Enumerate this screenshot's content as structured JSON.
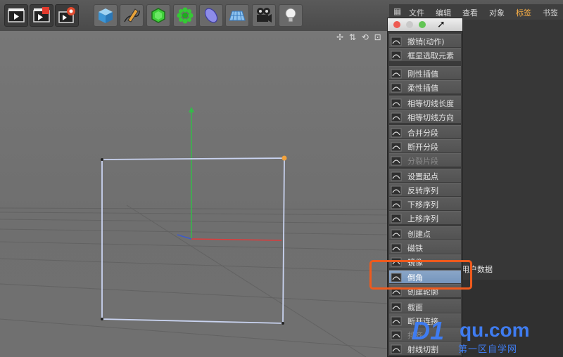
{
  "toolbar": {
    "buttons": [
      {
        "name": "render-view-icon"
      },
      {
        "name": "render-to-picture-viewer-icon"
      },
      {
        "name": "render-settings-icon"
      },
      {
        "name": "cube-icon"
      },
      {
        "name": "pen-spline-icon"
      },
      {
        "name": "subdivision-icon"
      },
      {
        "name": "array-icon"
      },
      {
        "name": "deformer-icon"
      },
      {
        "name": "floor-icon"
      },
      {
        "name": "camera-icon"
      },
      {
        "name": "light-icon"
      }
    ]
  },
  "menubar": {
    "items": [
      "文件",
      "编辑",
      "查看",
      "对象",
      "标签",
      "书签"
    ],
    "active": "标签"
  },
  "viewport": {
    "nav_icons": "✢ ⇅ ⟲ ⊡"
  },
  "popup_menu": {
    "items": [
      {
        "label": "撤销(动作)",
        "icon": "undo-icon",
        "state": "normal"
      },
      {
        "label": "框显选取元素",
        "icon": "frame-selection-icon",
        "state": "normal"
      },
      {
        "label": "刚性插值",
        "icon": "hard-interpolation-icon",
        "state": "normal"
      },
      {
        "label": "柔性插值",
        "icon": "soft-interpolation-icon",
        "state": "normal"
      },
      {
        "label": "相等切线长度",
        "icon": "equal-tangent-length-icon",
        "state": "normal"
      },
      {
        "label": "相等切线方向",
        "icon": "equal-tangent-direction-icon",
        "state": "normal"
      },
      {
        "label": "合并分段",
        "icon": "join-segment-icon",
        "state": "normal"
      },
      {
        "label": "断开分段",
        "icon": "break-segment-icon",
        "state": "normal"
      },
      {
        "label": "分裂片段",
        "icon": "explode-segments-icon",
        "state": "disabled"
      },
      {
        "label": "设置起点",
        "icon": "set-first-point-icon",
        "state": "normal"
      },
      {
        "label": "反转序列",
        "icon": "reverse-sequence-icon",
        "state": "normal"
      },
      {
        "label": "下移序列",
        "icon": "move-down-sequence-icon",
        "state": "normal"
      },
      {
        "label": "上移序列",
        "icon": "move-up-sequence-icon",
        "state": "normal"
      },
      {
        "label": "创建点",
        "icon": "create-point-icon",
        "state": "normal"
      },
      {
        "label": "磁铁",
        "icon": "magnet-icon",
        "state": "normal"
      },
      {
        "label": "镜像",
        "icon": "mirror-icon",
        "state": "normal"
      },
      {
        "label": "倒角",
        "icon": "chamfer-icon",
        "state": "selected"
      },
      {
        "label": "创建轮廓",
        "icon": "create-outline-icon",
        "state": "normal"
      },
      {
        "label": "截面",
        "icon": "cross-section-icon",
        "state": "normal"
      },
      {
        "label": "断开连接",
        "icon": "disconnect-icon",
        "state": "normal"
      },
      {
        "label": "排齐",
        "icon": "line-up-icon",
        "state": "disabled"
      },
      {
        "label": "射线切割",
        "icon": "line-cut-icon",
        "state": "normal"
      }
    ]
  },
  "attributes": {
    "title": "用户数据"
  },
  "watermark": {
    "logo": "D1",
    "domain": "qu.com",
    "subtitle": "第一区自学网"
  },
  "colors": {
    "highlight": "#ef5a1d",
    "active_menu": "#ffb347",
    "selected_item": "#7f9dc3",
    "spline": "#c9d3f0",
    "axis_y": "#35b94a",
    "axis_x": "#e03a3a"
  }
}
